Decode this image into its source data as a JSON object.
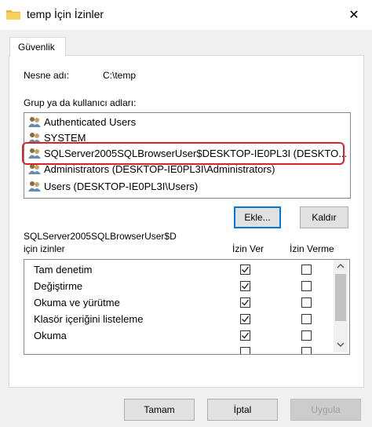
{
  "window": {
    "title": "temp İçin İzinler",
    "close_glyph": "✕"
  },
  "tabs": [
    {
      "label": "Güvenlik"
    }
  ],
  "object": {
    "label": "Nesne adı:",
    "value": "C:\\temp"
  },
  "groups": {
    "label": "Grup ya da kullanıcı adları:",
    "items": [
      {
        "label": "Authenticated Users",
        "icon": "users-icon"
      },
      {
        "label": "SYSTEM",
        "icon": "users-icon"
      },
      {
        "label": "SQLServer2005SQLBrowserUser$DESKTOP-IE0PL3I (DESKTO...",
        "icon": "users-icon"
      },
      {
        "label": "Administrators (DESKTOP-IE0PL3I\\Administrators)",
        "icon": "users-icon"
      },
      {
        "label": "Users (DESKTOP-IE0PL3I\\Users)",
        "icon": "users-icon"
      }
    ]
  },
  "actions": {
    "add": "Ekle...",
    "remove": "Kaldır"
  },
  "permissions": {
    "for_label_line1": "SQLServer2005SQLBrowserUser$D",
    "for_label_line2": "için izinler",
    "allow_header": "İzin Ver",
    "deny_header": "İzin Verme",
    "rows": [
      {
        "name": "Tam denetim",
        "allow": true,
        "deny": false
      },
      {
        "name": "Değiştirme",
        "allow": true,
        "deny": false
      },
      {
        "name": "Okuma ve yürütme",
        "allow": true,
        "deny": false
      },
      {
        "name": "Klasör içeriğini listeleme",
        "allow": true,
        "deny": false
      },
      {
        "name": "Okuma",
        "allow": true,
        "deny": false
      }
    ]
  },
  "footer": {
    "ok": "Tamam",
    "cancel": "İptal",
    "apply": "Uygula"
  }
}
